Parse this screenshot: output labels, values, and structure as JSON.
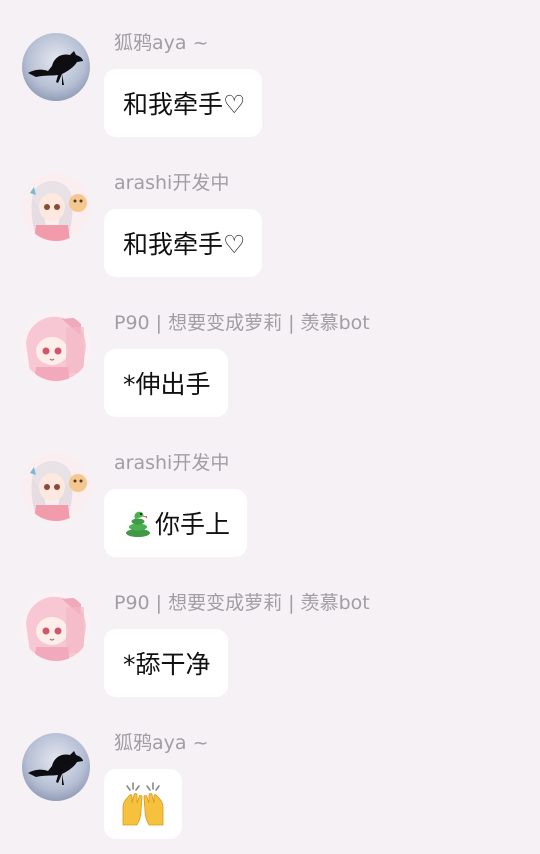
{
  "messages": [
    {
      "sender": "狐鸦aya ~",
      "text": "和我牵手♡",
      "avatar_icon": "crow-avatar-icon"
    },
    {
      "sender": "arashi开发中",
      "text": "和我牵手♡",
      "avatar_icon": "anime-girl-avatar-icon"
    },
    {
      "sender": "P90 | 想要变成萝莉 | 羡慕bot",
      "text": "*伸出手",
      "avatar_icon": "pink-anime-girl-avatar-icon"
    },
    {
      "sender": "arashi开发中",
      "text": "你手上",
      "emoji": "snake-emoji-icon",
      "avatar_icon": "anime-girl-avatar-icon"
    },
    {
      "sender": "P90 | 想要变成萝莉 | 羡慕bot",
      "text": "*舔干净",
      "avatar_icon": "pink-anime-girl-avatar-icon"
    },
    {
      "sender": "狐鸦aya ~",
      "emoji": "raising-hands-emoji-icon",
      "avatar_icon": "crow-avatar-icon"
    }
  ],
  "colors": {
    "background": "#f5f1f5",
    "bubble": "#ffffff",
    "sender_name": "#a29da4",
    "message_text": "#111111"
  }
}
